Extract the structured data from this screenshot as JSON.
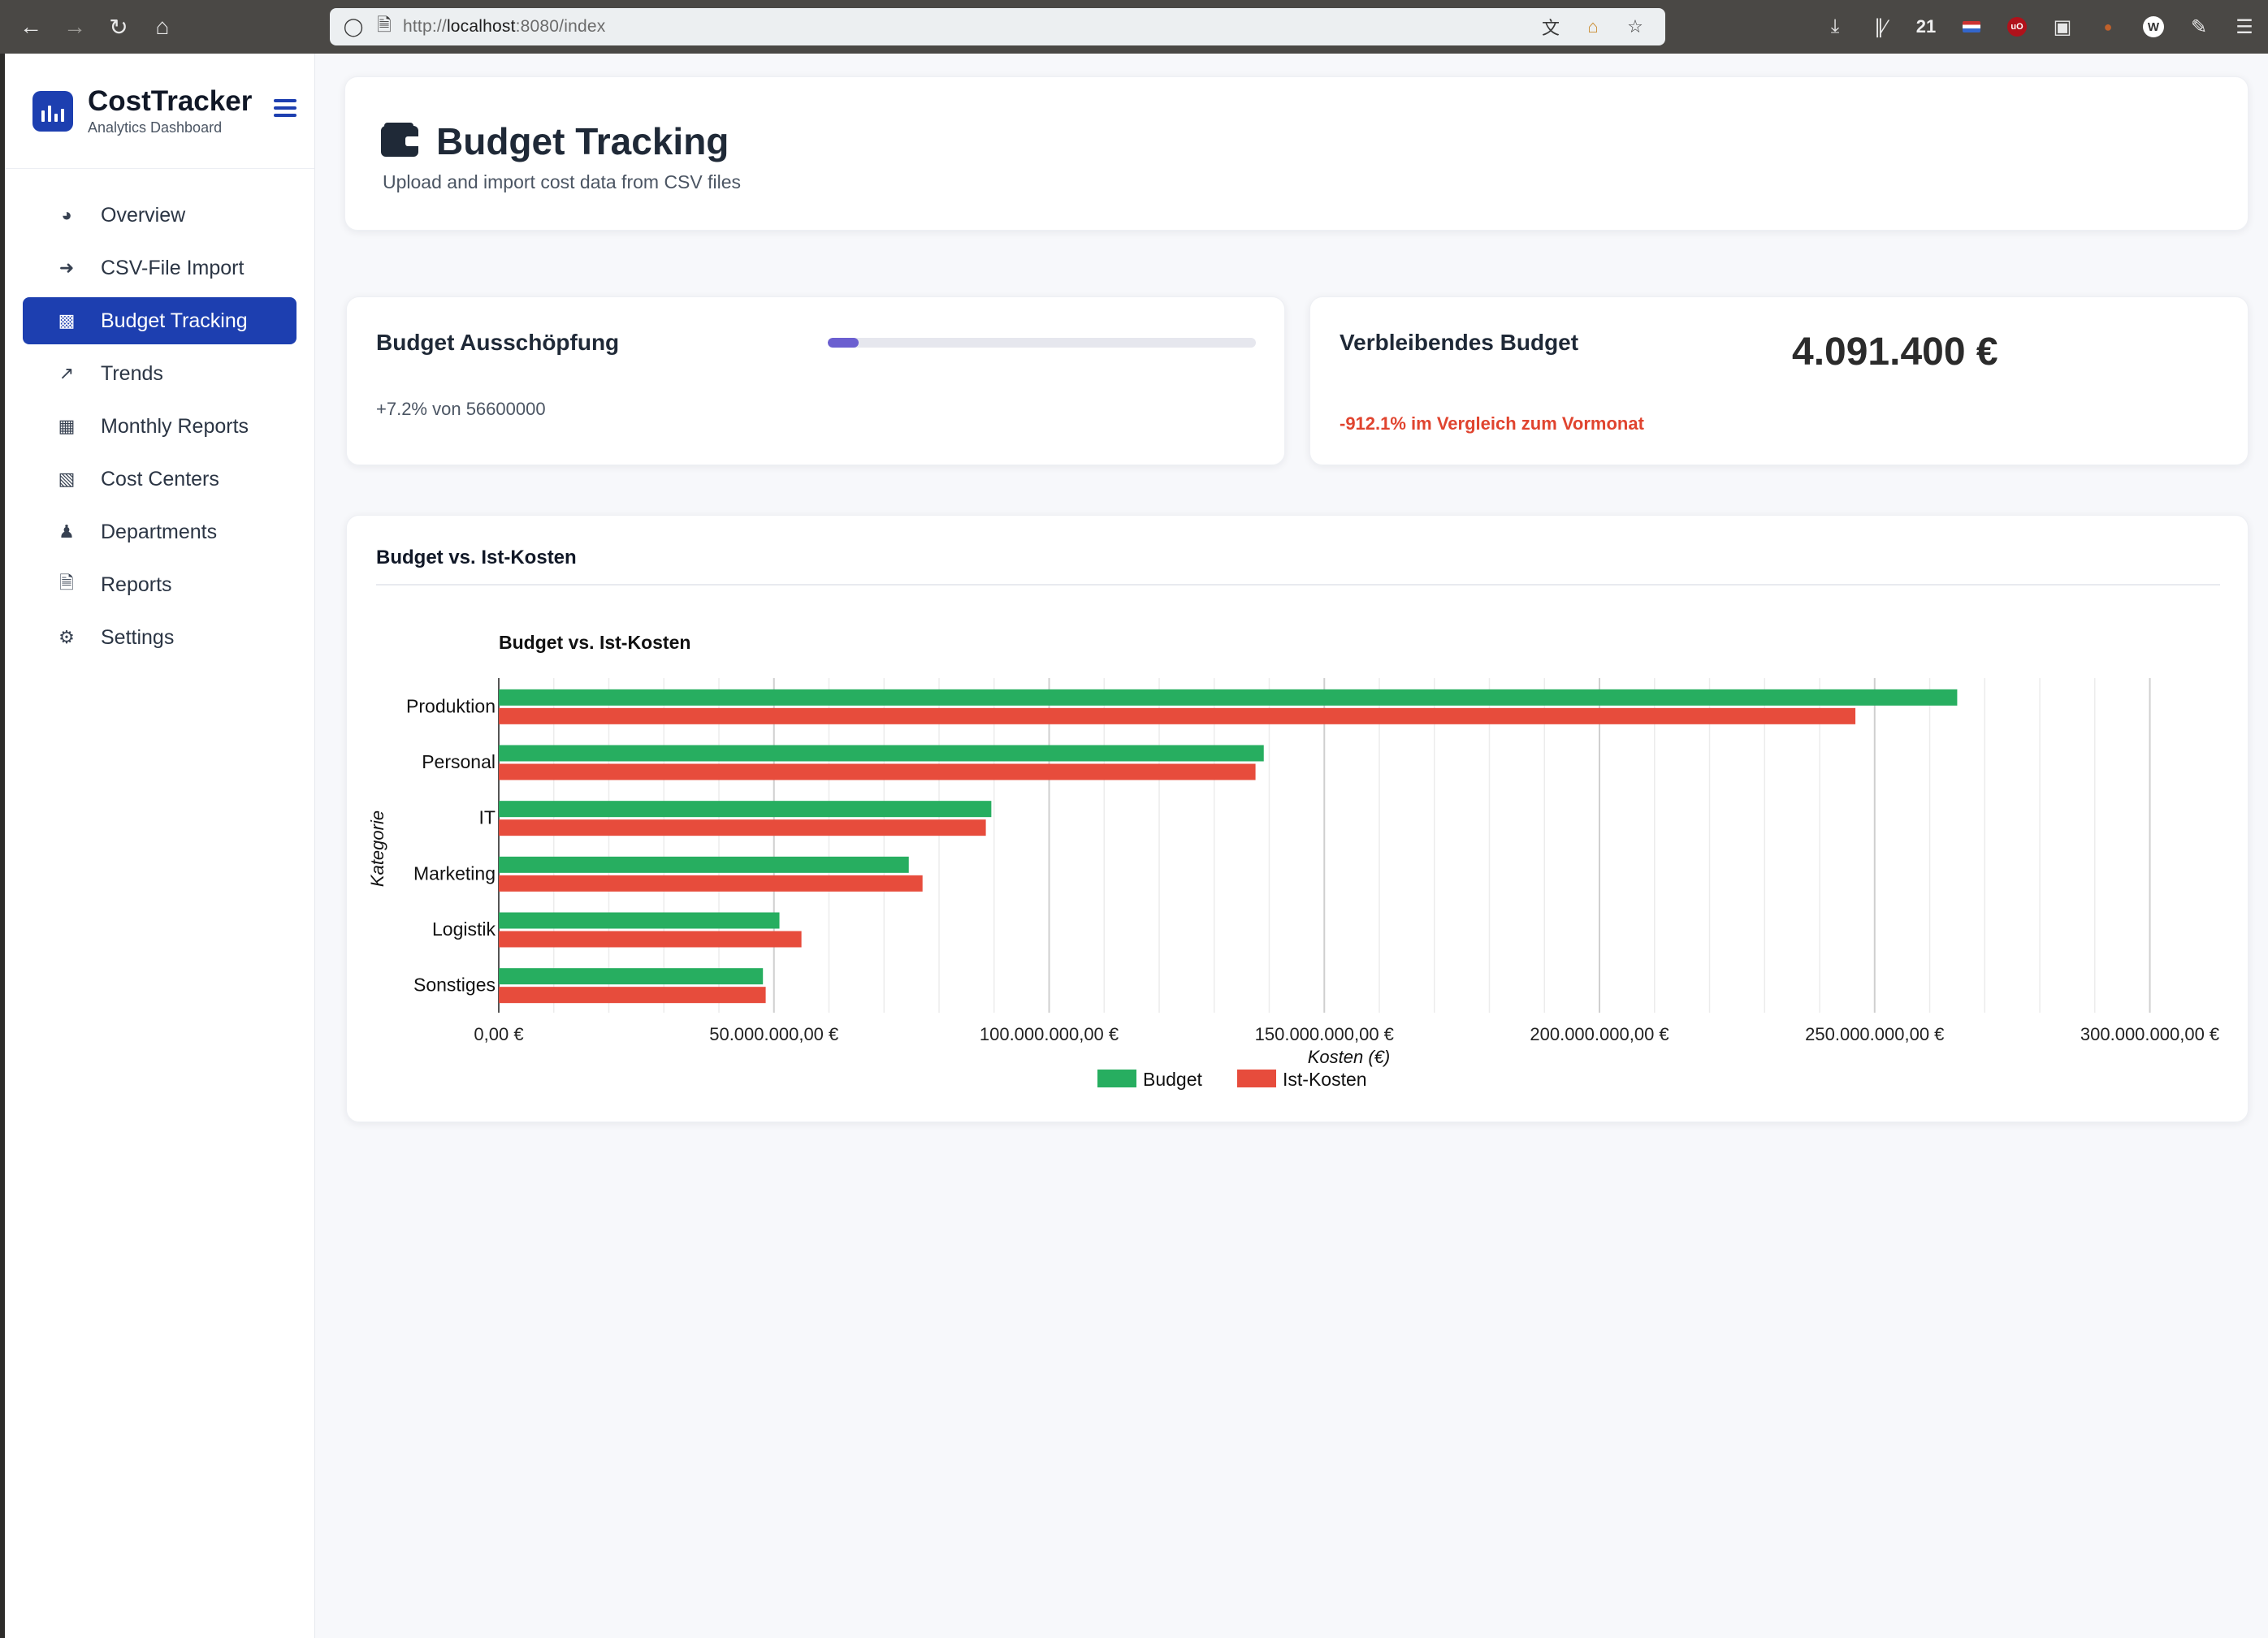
{
  "browser": {
    "url_prefix": "http://",
    "url_host": "localhost",
    "url_rest": ":8080/index",
    "extension_count": "21",
    "ext_ublock_label": "uO",
    "ext_w_label": "W",
    "icons": [
      "back-icon",
      "forward-icon",
      "reload-icon",
      "home-icon",
      "shield-icon",
      "page-icon",
      "translate-icon",
      "bookmark-star-icon",
      "download-icon",
      "library-icon",
      "extensions-icon",
      "menu-icon"
    ]
  },
  "sidebar": {
    "brand_title": "CostTracker",
    "brand_subtitle": "Analytics Dashboard",
    "items": [
      {
        "label": "Overview",
        "icon": "gauge-icon",
        "active": false
      },
      {
        "label": "CSV-File Import",
        "icon": "file-import-icon",
        "active": false
      },
      {
        "label": "Budget Tracking",
        "icon": "wallet-icon",
        "active": true
      },
      {
        "label": "Trends",
        "icon": "trend-icon",
        "active": false
      },
      {
        "label": "Monthly Reports",
        "icon": "calendar-icon",
        "active": false
      },
      {
        "label": "Cost Centers",
        "icon": "building-icon",
        "active": false
      },
      {
        "label": "Departments",
        "icon": "users-icon",
        "active": false
      },
      {
        "label": "Reports",
        "icon": "document-icon",
        "active": false
      },
      {
        "label": "Settings",
        "icon": "gear-icon",
        "active": false
      }
    ]
  },
  "header": {
    "title": "Budget Tracking",
    "subtitle": "Upload and import cost data from CSV files"
  },
  "kpi": {
    "utilization": {
      "title": "Budget Ausschöpfung",
      "progress_percent": 7.2,
      "subtext": "+7.2% von 56600000"
    },
    "remaining": {
      "title": "Verbleibendes Budget",
      "value": "4.091.400 €",
      "delta": "-912.1% im Vergleich zum Vormonat",
      "delta_color": "#e0442f"
    }
  },
  "chart_section": {
    "title": "Budget vs. Ist-Kosten"
  },
  "colors": {
    "accent": "#1d3fb0",
    "budget": "#27ae60",
    "actual": "#e74c3c",
    "progress": "#6b5fd0"
  },
  "chart_data": {
    "type": "bar",
    "orientation": "horizontal",
    "title": "Budget vs. Ist-Kosten",
    "xlabel": "Kosten (€)",
    "ylabel": "Kategorie",
    "xlim": [
      0,
      300000000
    ],
    "x_ticks": [
      0,
      50000000,
      100000000,
      150000000,
      200000000,
      250000000,
      300000000
    ],
    "x_tick_labels": [
      "0,00 €",
      "50.000.000,00 €",
      "100.000.000,00 €",
      "150.000.000,00 €",
      "200.000.000,00 €",
      "250.000.000,00 €",
      "300.000.000,00 €"
    ],
    "categories": [
      "Produktion",
      "Personal",
      "IT",
      "Marketing",
      "Logistik",
      "Sonstiges"
    ],
    "series": [
      {
        "name": "Budget",
        "color": "#27ae60",
        "values": [
          265000000,
          139000000,
          89500000,
          74500000,
          51000000,
          48000000
        ]
      },
      {
        "name": "Ist-Kosten",
        "color": "#e74c3c",
        "values": [
          246500000,
          137500000,
          88500000,
          77000000,
          55000000,
          48500000
        ]
      }
    ],
    "grid": true,
    "legend_position": "bottom"
  }
}
